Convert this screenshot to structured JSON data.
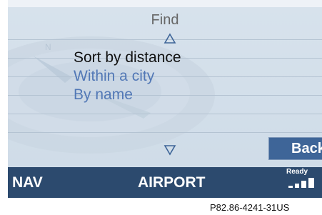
{
  "screen": {
    "title": "Find",
    "menu_items": [
      {
        "label": "Sort by distance",
        "selected": true
      },
      {
        "label": "Within a city",
        "selected": false
      },
      {
        "label": "By name",
        "selected": false
      }
    ],
    "back_label": "Back"
  },
  "status_bar": {
    "mode": "NAV",
    "location": "AIRPORT",
    "status": "Ready"
  },
  "caption": "P82.86-4241-31US",
  "colors": {
    "background": "#d7e2ec",
    "status_bar": "#2c4a6e",
    "accent_text": "#5278b6",
    "selected_text": "#111111",
    "button": "#3e6598"
  }
}
